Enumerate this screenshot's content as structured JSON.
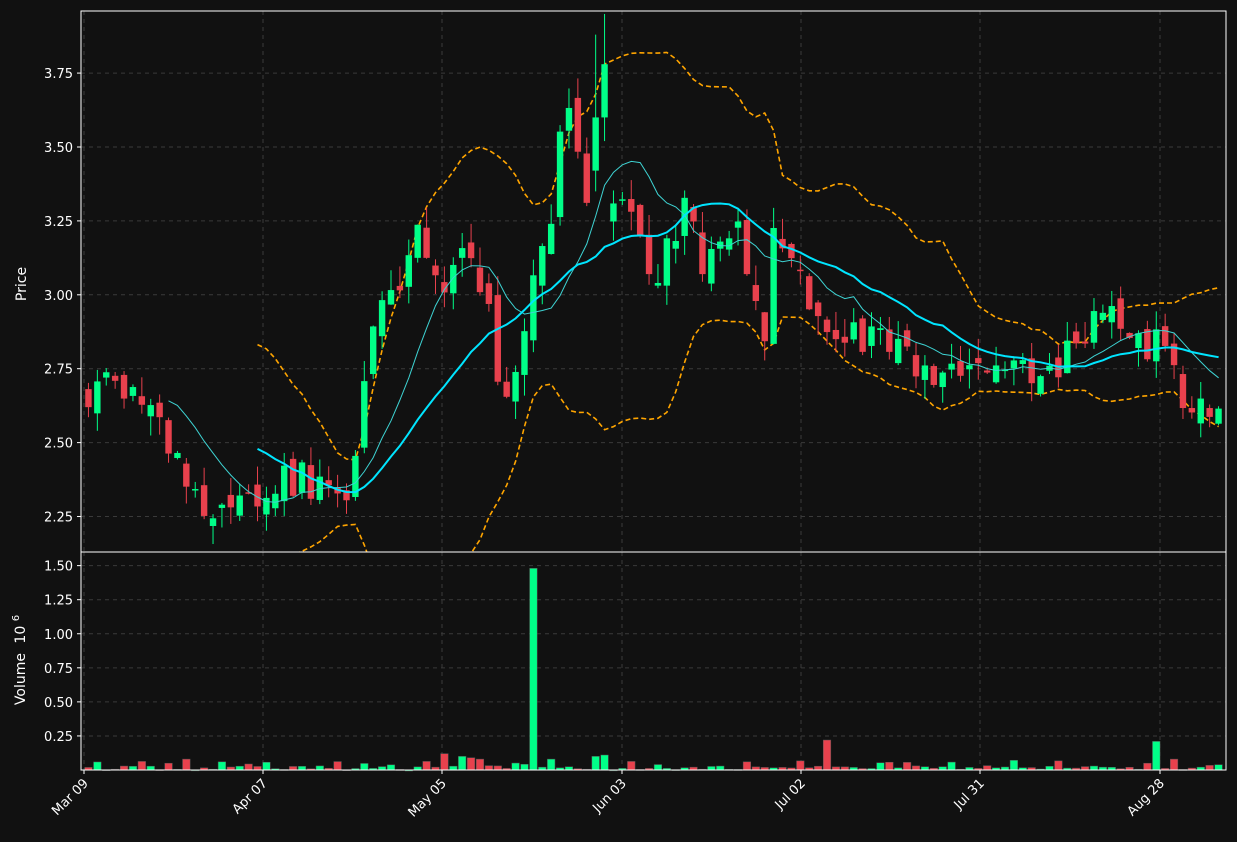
{
  "colors": {
    "background": "#111111",
    "frame": "#ffffff",
    "grid": "#3a3a3a",
    "up": "#00ff88",
    "down": "#e8414d",
    "ma_fast": "#3ed3d3",
    "ma_slow": "#00e5ff",
    "bollinger": "#ffa500",
    "text": "#ffffff"
  },
  "chart_data": [
    {
      "type": "candlestick",
      "ylabel": "Price",
      "ylim": [
        2.13,
        3.96
      ],
      "yticks": [
        "2.25",
        "2.50",
        "2.75",
        "3.00",
        "3.25",
        "3.50",
        "3.75"
      ],
      "xticks": [
        "Mar 09",
        "Apr 07",
        "May 05",
        "Jun 03",
        "Jul 02",
        "Jul 31",
        "Aug 28"
      ],
      "grid": true,
      "series": [
        {
          "kind": "candles",
          "ohlc": []
        },
        {
          "kind": "line",
          "style": "thin",
          "values": []
        },
        {
          "kind": "line",
          "style": "thick",
          "values": []
        },
        {
          "kind": "band-upper",
          "style": "dashed",
          "values": []
        },
        {
          "kind": "band-lower",
          "style": "dashed",
          "values": []
        }
      ]
    },
    {
      "type": "bar",
      "ylabel": "Volume",
      "yscale_label": "10",
      "yscale_exponent": "6",
      "ylim": [
        0,
        1.6
      ],
      "yticks": [
        "0.25",
        "0.50",
        "0.75",
        "1.00",
        "1.25",
        "1.50"
      ],
      "grid": true,
      "values_millions": []
    }
  ]
}
